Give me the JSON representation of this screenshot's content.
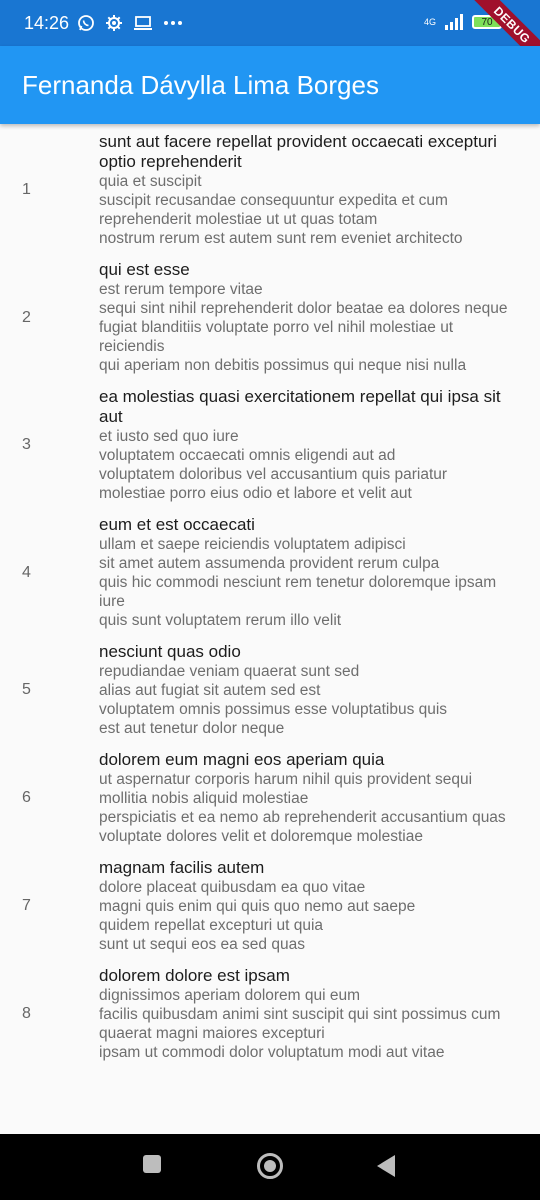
{
  "status_bar": {
    "time": "14:26",
    "network": "4G",
    "battery": "70",
    "icons": [
      "whatsapp-icon",
      "gear-icon",
      "laptop-icon",
      "more-dots-icon",
      "signal-icon",
      "battery-icon"
    ]
  },
  "debug_banner": "DEBUG",
  "app_bar": {
    "title": "Fernanda Dávylla Lima Borges",
    "color": "#2196f3"
  },
  "posts": [
    {
      "id": "1",
      "title": "sunt aut facere repellat provident occaecati excepturi optio reprehenderit",
      "body": "quia et suscipit\nsuscipit recusandae consequuntur expedita et cum reprehenderit molestiae ut ut quas totam\nnostrum rerum est autem sunt rem eveniet architecto"
    },
    {
      "id": "2",
      "title": "qui est esse",
      "body": "est rerum tempore vitae\nsequi sint nihil reprehenderit dolor beatae ea dolores neque\nfugiat blanditiis voluptate porro vel nihil molestiae ut reiciendis\nqui aperiam non debitis possimus qui neque nisi nulla"
    },
    {
      "id": "3",
      "title": "ea molestias quasi exercitationem repellat qui ipsa sit aut",
      "body": "et iusto sed quo iure\nvoluptatem occaecati omnis eligendi aut ad\nvoluptatem doloribus vel accusantium quis pariatur\nmolestiae porro eius odio et labore et velit aut"
    },
    {
      "id": "4",
      "title": "eum et est occaecati",
      "body": "ullam et saepe reiciendis voluptatem adipisci\nsit amet autem assumenda provident rerum culpa\nquis hic commodi nesciunt rem tenetur doloremque ipsam iure\nquis sunt voluptatem rerum illo velit"
    },
    {
      "id": "5",
      "title": "nesciunt quas odio",
      "body": "repudiandae veniam quaerat sunt sed\nalias aut fugiat sit autem sed est\nvoluptatem omnis possimus esse voluptatibus quis\nest aut tenetur dolor neque"
    },
    {
      "id": "6",
      "title": "dolorem eum magni eos aperiam quia",
      "body": "ut aspernatur corporis harum nihil quis provident sequi\nmollitia nobis aliquid molestiae\nperspiciatis et ea nemo ab reprehenderit accusantium quas\nvoluptate dolores velit et doloremque molestiae"
    },
    {
      "id": "7",
      "title": "magnam facilis autem",
      "body": "dolore placeat quibusdam ea quo vitae\nmagni quis enim qui quis quo nemo aut saepe\nquidem repellat excepturi ut quia\nsunt ut sequi eos ea sed quas"
    },
    {
      "id": "8",
      "title": "dolorem dolore est ipsam",
      "body": "dignissimos aperiam dolorem qui eum\nfacilis quibusdam animi sint suscipit qui sint possimus cum\nquaerat magni maiores excepturi\nipsam ut commodi dolor voluptatum modi aut vitae"
    }
  ],
  "nav_bar": {
    "buttons": [
      "recents-square-icon",
      "home-circle-icon",
      "back-triangle-icon"
    ]
  }
}
